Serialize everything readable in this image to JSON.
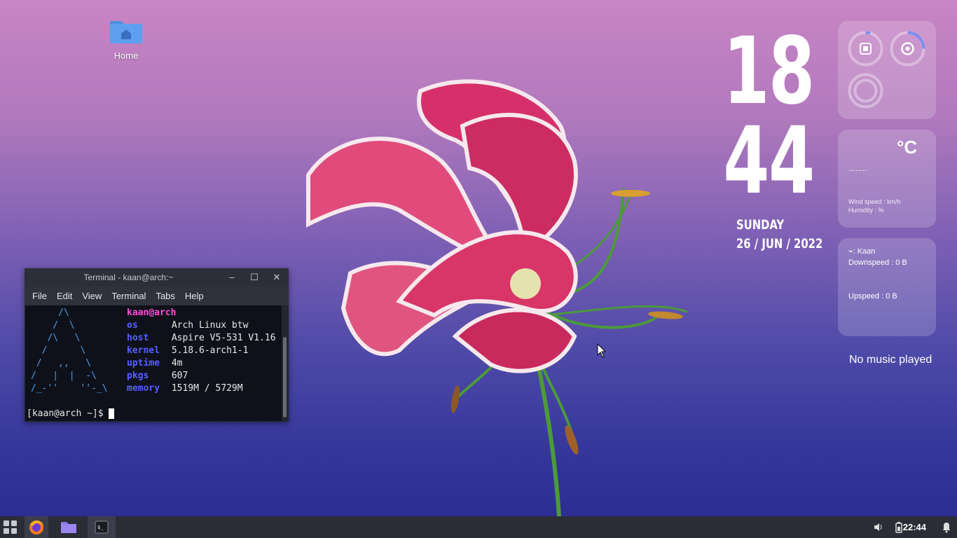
{
  "desktop": {
    "home_label": "Home"
  },
  "clock": {
    "hour": "18",
    "minute": "44",
    "day": "SUNDAY",
    "date": "26 / JUN / 2022"
  },
  "weather": {
    "unit": "°C",
    "desc": "........",
    "wind": "Wind speed : km/h",
    "humidity": "Humidity : %"
  },
  "network": {
    "title": ": Kaan",
    "down": "Downspeed : 0 B",
    "up": "Upspeed : 0 B"
  },
  "music": {
    "status": "No music played"
  },
  "terminal": {
    "title": "Terminal - kaan@arch:~",
    "menu": [
      "File",
      "Edit",
      "View",
      "Terminal",
      "Tabs",
      "Help"
    ],
    "ascii": "     /\\\n    /  \\\n   /\\   \\\n  /      \\\n /   ,,   \\\n/   |  |  -\\\n/_-''    ''-_\\",
    "user": "kaan@arch",
    "fields": [
      {
        "key": "os",
        "value": "Arch Linux btw"
      },
      {
        "key": "host",
        "value": "Aspire V5-531 V1.16"
      },
      {
        "key": "kernel",
        "value": "5.18.6-arch1-1"
      },
      {
        "key": "uptime",
        "value": "4m"
      },
      {
        "key": "pkgs",
        "value": "607"
      },
      {
        "key": "memory",
        "value": "1519M / 5729M"
      }
    ],
    "prompt": "[kaan@arch ~]$ "
  },
  "taskbar": {
    "time": "22:44"
  },
  "colors": {
    "accent": "#5560ff",
    "user": "#ff4fd8",
    "ring": "#7a8ff0"
  }
}
